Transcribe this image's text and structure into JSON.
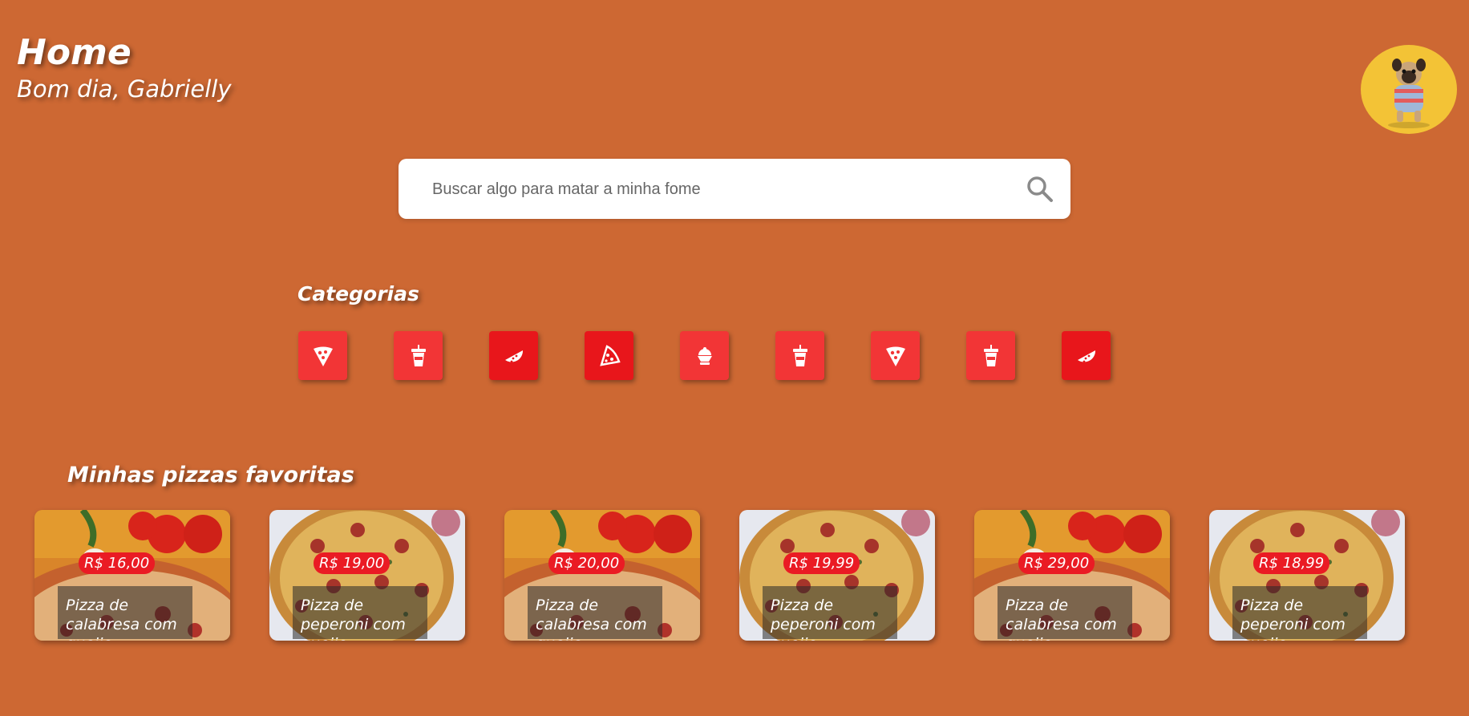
{
  "header": {
    "title": "Home",
    "greeting": "Bom dia, Gabrielly",
    "avatar_icon": "pug-avatar-icon"
  },
  "search": {
    "placeholder": "Buscar algo para matar a minha fome",
    "value": "",
    "icon": "search-icon"
  },
  "categories": {
    "title": "Categorias",
    "items": [
      {
        "icon": "pizza-slice-icon"
      },
      {
        "icon": "drink-cup-icon"
      },
      {
        "icon": "watermelon-icon"
      },
      {
        "icon": "pizza-slice-icon"
      },
      {
        "icon": "ice-cream-icon"
      },
      {
        "icon": "drink-cup-icon"
      },
      {
        "icon": "pizza-slice-icon"
      },
      {
        "icon": "drink-cup-icon"
      },
      {
        "icon": "watermelon-icon"
      }
    ]
  },
  "favorites": {
    "title": "Minhas pizzas favoritas",
    "items": [
      {
        "price": "R$ 16,00",
        "name": "Pizza de calabresa com queijo",
        "image": "calabresa-pizza-photo"
      },
      {
        "price": "R$ 19,00",
        "name": "Pizza de peperoni com queijo",
        "image": "peperoni-pizza-photo"
      },
      {
        "price": "R$ 20,00",
        "name": "Pizza de calabresa com queijo",
        "image": "calabresa-pizza-photo"
      },
      {
        "price": "R$ 19,99",
        "name": "Pizza de peperoni com queijo",
        "image": "peperoni-pizza-photo"
      },
      {
        "price": "R$ 29,00",
        "name": "Pizza de calabresa com queijo",
        "image": "calabresa-pizza-photo"
      },
      {
        "price": "R$ 18,99",
        "name": "Pizza de peperoni com queijo",
        "image": "peperoni-pizza-photo"
      }
    ]
  },
  "colors": {
    "background": "#cd6833",
    "category_tile": "#f23536",
    "price_badge": "#ea1b24",
    "avatar_bg": "#f3c336"
  }
}
